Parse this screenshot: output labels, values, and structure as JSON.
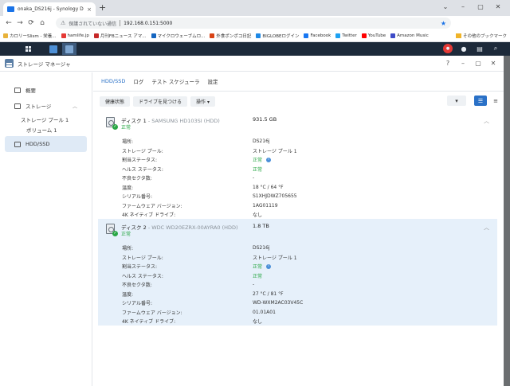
{
  "browser": {
    "tab_title": "onaka_DS216j - Synology DiskSt",
    "tab_close": "×",
    "new_tab": "+",
    "security_label": "保護されていない通信",
    "url": "192.168.0.151:5000",
    "bookmarks": [
      "カロリーSlism - 栄養...",
      "hamlife.jp",
      "月刊FBニュース アマ...",
      "マイクロウェーブムロ...",
      "外食ポンポコ日記",
      "BIGLOBEログイン",
      "Facebook",
      "Twitter",
      "YouTube",
      "Amazon Music"
    ],
    "bookmark_folder": "その他のブックマーク",
    "bookmark_colors": [
      "#e8b23a",
      "#e53935",
      "#c62828",
      "#1565c0",
      "#d84315",
      "#1e88e5",
      "#1877f2",
      "#1da1f2",
      "#ff0000",
      "#3d4bc7"
    ]
  },
  "app": {
    "title": "ストレージ マネージャ",
    "help": "?"
  },
  "sidebar": {
    "overview": "概要",
    "storage": "ストレージ",
    "pool": "ストレージ プール 1",
    "volume": "ボリューム 1",
    "hdd": "HDD/SSD"
  },
  "tabs": [
    "HDD/SSD",
    "ログ",
    "テスト スケジューラ",
    "設定"
  ],
  "toolbar": {
    "health": "健康状態",
    "locate": "ドライブを見つける",
    "action": "操作 ▾"
  },
  "disks": [
    {
      "name": "ディスク 1",
      "model": " - SAMSUNG HD103SI (HDD)",
      "status": "正常",
      "capacity": "931.5 GB",
      "rows": [
        {
          "k": "場所:",
          "v": "DS216j"
        },
        {
          "k": "ストレージ プール:",
          "v": "ストレージ プール 1"
        },
        {
          "k": "割当ステータス:",
          "v": "正常"
        },
        {
          "k": "ヘルス ステータス:",
          "v": "正常"
        },
        {
          "k": "不良セクタ数:",
          "v": "-"
        },
        {
          "k": "温度:",
          "v": "18 °C / 64 °F"
        },
        {
          "k": "シリアル番号:",
          "v": "S1XHJDWZ705655"
        },
        {
          "k": "ファームウェア バージョン:",
          "v": "1AG01119"
        },
        {
          "k": "4K ネイティブ ドライブ:",
          "v": "なし"
        }
      ]
    },
    {
      "name": "ディスク 2",
      "model": " - WDC WD20EZRX-00AYRA0 (HDD)",
      "status": "正常",
      "capacity": "1.8 TB",
      "rows": [
        {
          "k": "場所:",
          "v": "DS216j"
        },
        {
          "k": "ストレージ プール:",
          "v": "ストレージ プール 1"
        },
        {
          "k": "割当ステータス:",
          "v": "正常"
        },
        {
          "k": "ヘルス ステータス:",
          "v": "正常"
        },
        {
          "k": "不良セクタ数:",
          "v": "-"
        },
        {
          "k": "温度:",
          "v": "27 °C / 81 °F"
        },
        {
          "k": "シリアル番号:",
          "v": "WD-WXM2AC03V45C"
        },
        {
          "k": "ファームウェア バージョン:",
          "v": "01.01A01"
        },
        {
          "k": "4K ネイティブ ドライブ:",
          "v": "なし"
        }
      ]
    }
  ]
}
